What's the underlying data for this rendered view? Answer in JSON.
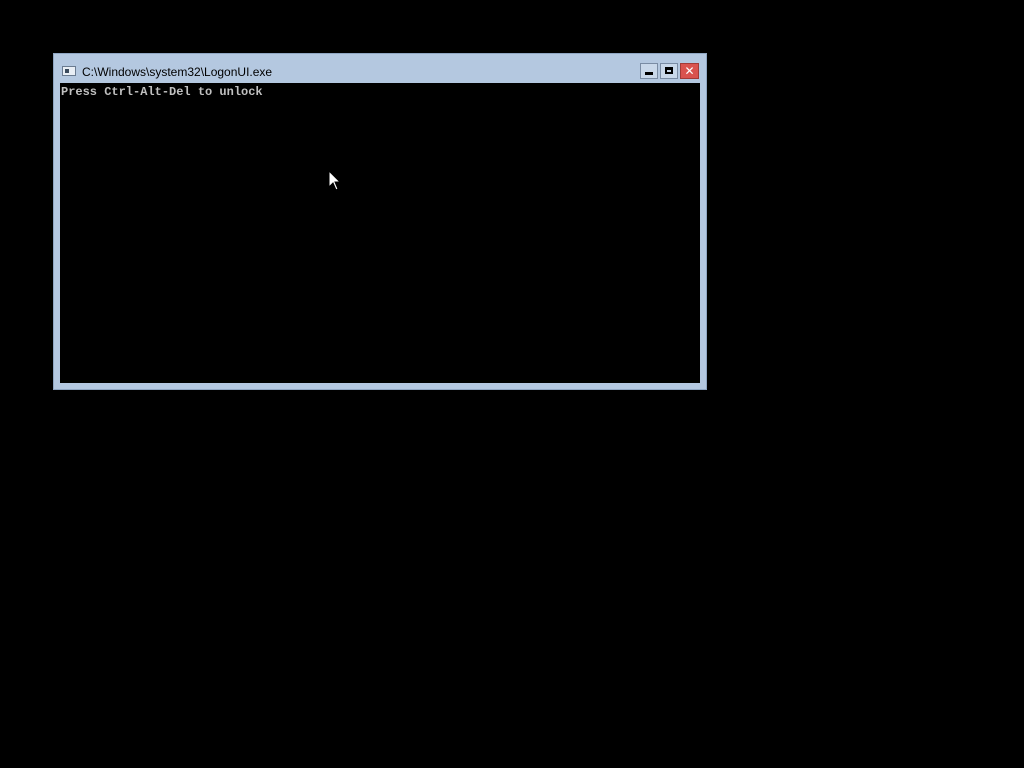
{
  "window": {
    "title": "C:\\Windows\\system32\\LogonUI.exe",
    "icon": "console-app-icon",
    "controls": {
      "minimize_icon": "minimize-icon",
      "maximize_icon": "maximize-icon",
      "close_icon": "close-icon",
      "close_glyph": "✕"
    }
  },
  "console": {
    "text": "Press Ctrl-Alt-Del to unlock",
    "foreground_color": "#c0c0c0",
    "background_color": "#000000"
  },
  "colors": {
    "desktop": "#000000",
    "window_frame": "#b4c8e0",
    "close_button": "#d9534f"
  },
  "cursor": {
    "icon": "arrow-pointer-icon"
  }
}
